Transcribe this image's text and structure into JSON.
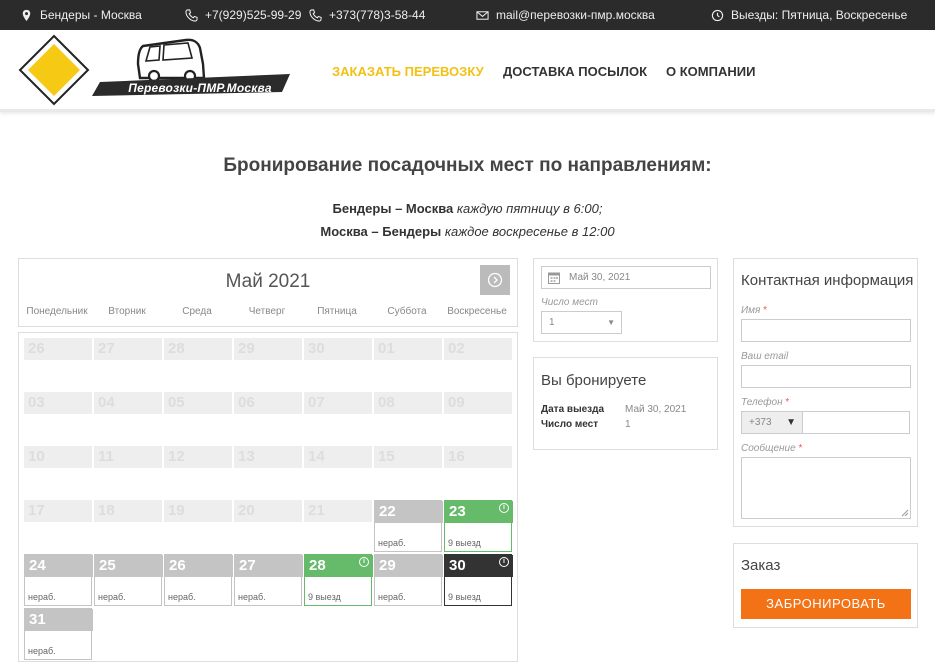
{
  "topbar": {
    "route": "Бендеры - Москва",
    "phone1": "+7(929)525-99-29",
    "phone2": "+373(778)3-58-44",
    "email": "mail@перевозки-пмр.москва",
    "schedule": "Выезды: Пятница, Воскресенье"
  },
  "header": {
    "logo_text": "Перевозки-ПМР.Москва",
    "nav": [
      "ЗАКАЗАТЬ ПЕРЕВОЗКУ",
      "ДОСТАВКА ПОСЫЛОК",
      "О КОМПАНИИ"
    ],
    "active_color": "#f2c114"
  },
  "page": {
    "title": "Бронирование посадочных мест по направлениям:",
    "routes": [
      {
        "name": "Бендеры – Москва",
        "when": "каждую пятницу в 6:00;"
      },
      {
        "name": "Москва – Бендеры",
        "when": "каждое воскресенье в 12:00"
      }
    ]
  },
  "calendar": {
    "month": "Май 2021",
    "weekdays": [
      "Понедельник",
      "Вторник",
      "Среда",
      "Четверг",
      "Пятница",
      "Суббота",
      "Воскресенье"
    ],
    "weeks": [
      [
        {
          "n": "26",
          "s": "past"
        },
        {
          "n": "27",
          "s": "past"
        },
        {
          "n": "28",
          "s": "past"
        },
        {
          "n": "29",
          "s": "past"
        },
        {
          "n": "30",
          "s": "past"
        },
        {
          "n": "01",
          "s": "past"
        },
        {
          "n": "02",
          "s": "past"
        }
      ],
      [
        {
          "n": "03",
          "s": "past"
        },
        {
          "n": "04",
          "s": "past"
        },
        {
          "n": "05",
          "s": "past"
        },
        {
          "n": "06",
          "s": "past"
        },
        {
          "n": "07",
          "s": "past"
        },
        {
          "n": "08",
          "s": "past"
        },
        {
          "n": "09",
          "s": "past"
        }
      ],
      [
        {
          "n": "10",
          "s": "past"
        },
        {
          "n": "11",
          "s": "past"
        },
        {
          "n": "12",
          "s": "past"
        },
        {
          "n": "13",
          "s": "past"
        },
        {
          "n": "14",
          "s": "past"
        },
        {
          "n": "15",
          "s": "past"
        },
        {
          "n": "16",
          "s": "past"
        }
      ],
      [
        {
          "n": "17",
          "s": "past"
        },
        {
          "n": "18",
          "s": "past"
        },
        {
          "n": "19",
          "s": "past"
        },
        {
          "n": "20",
          "s": "past"
        },
        {
          "n": "21",
          "s": "past"
        },
        {
          "n": "22",
          "s": "closed",
          "t": "нераб."
        },
        {
          "n": "23",
          "s": "green",
          "t": "9 выезд",
          "i": true
        }
      ],
      [
        {
          "n": "24",
          "s": "closed",
          "t": "нераб."
        },
        {
          "n": "25",
          "s": "closed",
          "t": "нераб."
        },
        {
          "n": "26",
          "s": "closed",
          "t": "нераб."
        },
        {
          "n": "27",
          "s": "closed",
          "t": "нераб."
        },
        {
          "n": "28",
          "s": "green",
          "t": "9 выезд",
          "i": true
        },
        {
          "n": "29",
          "s": "closed",
          "t": "нераб."
        },
        {
          "n": "30",
          "s": "dark",
          "t": "9 выезд",
          "i": true
        }
      ],
      [
        {
          "n": "31",
          "s": "closed",
          "t": "нераб."
        }
      ]
    ],
    "status_colors": {
      "available": "#66bb6a",
      "selected": "#333333",
      "closed": "#c4c4c4"
    }
  },
  "booking": {
    "date_value": "Май 30, 2021",
    "seats_label": "Число мест",
    "seats_value": "1",
    "summary_title": "Вы бронируете",
    "summary": [
      {
        "k": "Дата выезда",
        "v": "Май 30, 2021"
      },
      {
        "k": "Число мест",
        "v": "1"
      }
    ]
  },
  "contact": {
    "title": "Контактная информация",
    "name_label": "Имя",
    "email_label": "Ваш email",
    "phone_label": "Телефон",
    "phone_code": "+373",
    "message_label": "Сообщение",
    "required_mark": "*"
  },
  "order": {
    "title": "Заказ",
    "button": "ЗАБРОНИРОВАТЬ",
    "button_color": "#f47216"
  }
}
